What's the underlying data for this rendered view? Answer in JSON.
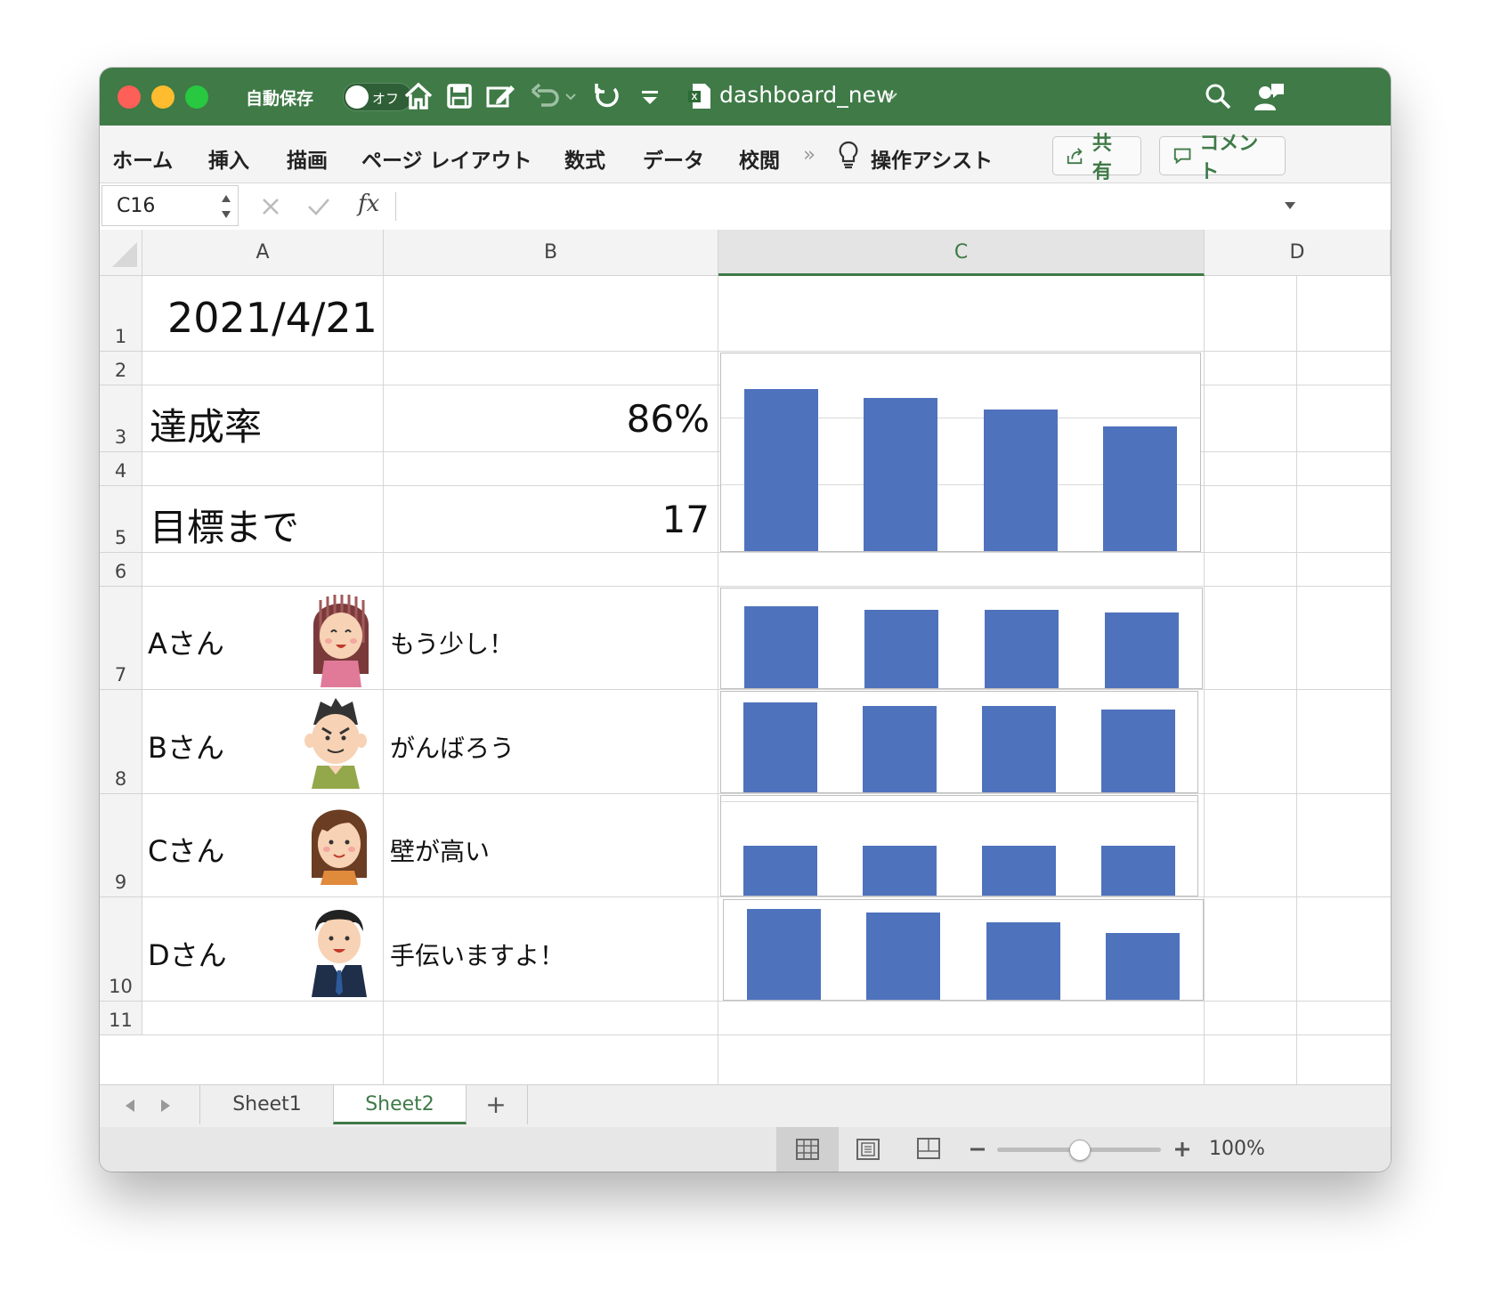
{
  "title": {
    "autosave_label": "自動保存",
    "autosave_state": "オフ",
    "filename": "dashboard_new"
  },
  "ribbon": {
    "tabs": [
      "ホーム",
      "挿入",
      "描画",
      "ページ レイアウト",
      "数式",
      "データ",
      "校閲"
    ],
    "more": "»",
    "assist": "操作アシスト",
    "share": "共有",
    "comment": "コメント"
  },
  "formula_bar": {
    "name_box": "C16",
    "fx": "fx",
    "content": ""
  },
  "columns": [
    "A",
    "B",
    "C",
    "D"
  ],
  "rows": [
    "1",
    "2",
    "3",
    "4",
    "5",
    "6",
    "7",
    "8",
    "9",
    "10",
    "11"
  ],
  "cells": {
    "a1": "2021/4/21",
    "a3": "達成率",
    "b3": "86%",
    "a5": "目標まで",
    "b5": "17"
  },
  "people": [
    {
      "name": "Aさん",
      "comment": "もう少し！",
      "avatar": "girl-avatar-icon"
    },
    {
      "name": "Bさん",
      "comment": "がんばろう",
      "avatar": "boy-avatar-icon"
    },
    {
      "name": "Cさん",
      "comment": "壁が高い",
      "avatar": "woman-avatar-icon"
    },
    {
      "name": "Dさん",
      "comment": "手伝いますよ！",
      "avatar": "businessman-avatar-icon"
    }
  ],
  "chart_data": [
    {
      "type": "bar",
      "values": [
        0.86,
        0.81,
        0.75,
        0.66
      ],
      "ylim": [
        0,
        1
      ],
      "grid": true
    },
    {
      "type": "bar",
      "values": [
        0.9,
        0.86,
        0.86,
        0.83
      ],
      "ylim": [
        0,
        1
      ],
      "grid": false
    },
    {
      "type": "bar",
      "values": [
        0.98,
        0.94,
        0.94,
        0.9
      ],
      "ylim": [
        0,
        1
      ],
      "grid": false
    },
    {
      "type": "bar",
      "values": [
        0.55,
        0.55,
        0.55,
        0.55
      ],
      "ylim": [
        0,
        1
      ],
      "grid": true
    },
    {
      "type": "bar",
      "values": [
        1.0,
        0.96,
        0.85,
        0.74
      ],
      "ylim": [
        0,
        1
      ],
      "grid": false
    }
  ],
  "sheets": {
    "tabs": [
      "Sheet1",
      "Sheet2"
    ],
    "active": "Sheet2",
    "add": "+"
  },
  "status": {
    "zoom": "100%",
    "zoom_level": 0.5
  },
  "colors": {
    "titlebar": "#3f7a47",
    "bar": "#4f72bd",
    "selected_column": "#3f7a47"
  }
}
